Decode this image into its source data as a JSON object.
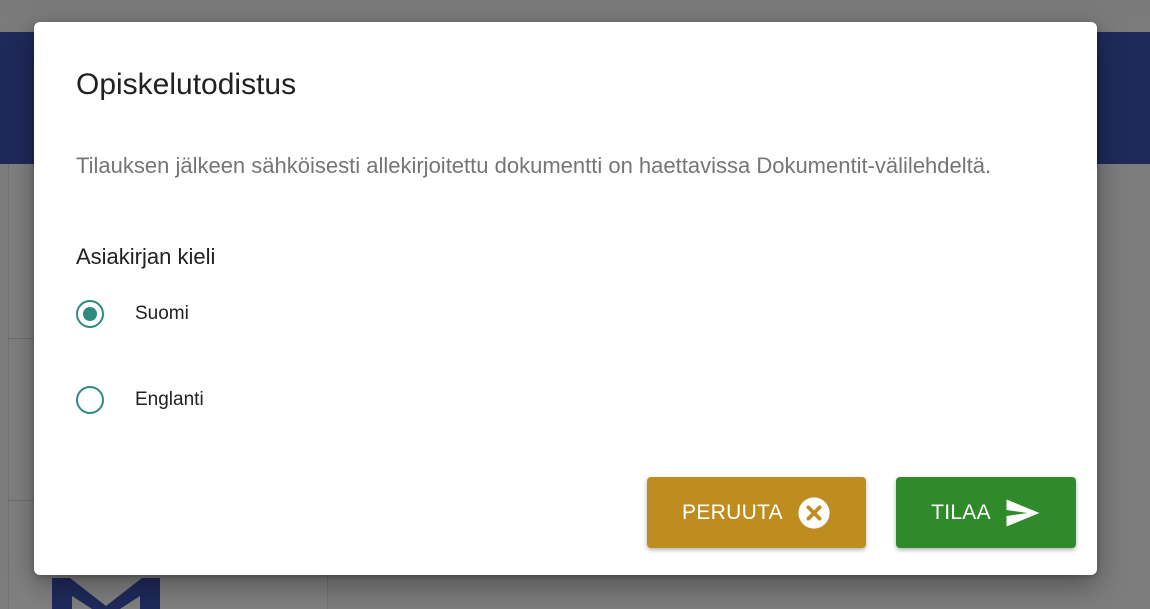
{
  "dialog": {
    "title": "Opiskelutodistus",
    "description": "Tilauksen jälkeen sähköisesti allekirjoitettu dokumentti on haettavissa Dokumentit-välilehdeltä.",
    "language_label": "Asiakirjan kieli",
    "options": [
      {
        "label": "Suomi",
        "selected": true
      },
      {
        "label": "Englanti",
        "selected": false
      }
    ],
    "buttons": {
      "cancel": {
        "label": "PERUUTA",
        "icon": "close-circle-icon",
        "color": "#bf8c1f"
      },
      "submit": {
        "label": "TILAA",
        "icon": "send-icon",
        "color": "#2f8a2a"
      }
    }
  },
  "colors": {
    "radio_accent": "#2e8b80",
    "navbar": "#1f2a5b",
    "overlay": "#7b7b7b"
  }
}
